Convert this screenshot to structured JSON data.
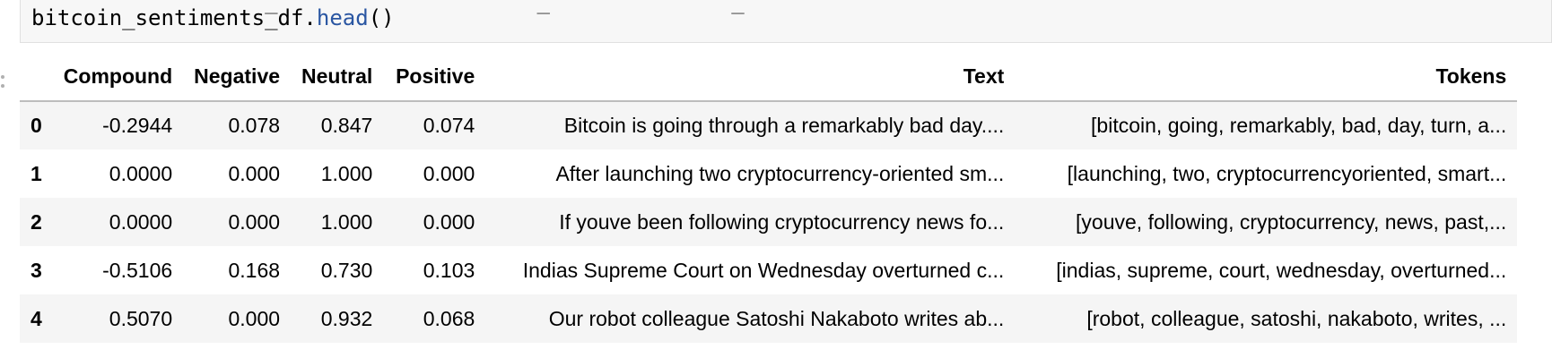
{
  "code_cell": {
    "previous_line_fragment": "                  _                    _              _",
    "line_object": "bitcoin_sentiments_df.",
    "line_method": "head",
    "line_parens": "()"
  },
  "dataframe": {
    "columns": [
      "",
      "Compound",
      "Negative",
      "Neutral",
      "Positive",
      "Text",
      "Tokens"
    ],
    "rows": [
      [
        "0",
        "-0.2944",
        "0.078",
        "0.847",
        "0.074",
        "Bitcoin is going through a remarkably bad day....",
        "[bitcoin, going, remarkably, bad, day, turn, a..."
      ],
      [
        "1",
        "0.0000",
        "0.000",
        "1.000",
        "0.000",
        "After launching two cryptocurrency-oriented sm...",
        "[launching, two, cryptocurrencyoriented, smart..."
      ],
      [
        "2",
        "0.0000",
        "0.000",
        "1.000",
        "0.000",
        "If youve been following cryptocurrency news fo...",
        "[youve, following, cryptocurrency, news, past,..."
      ],
      [
        "3",
        "-0.5106",
        "0.168",
        "0.730",
        "0.103",
        "Indias Supreme Court on Wednesday overturned c...",
        "[indias, supreme, court, wednesday, overturned..."
      ],
      [
        "4",
        "0.5070",
        "0.000",
        "0.932",
        "0.068",
        "Our robot colleague Satoshi Nakaboto writes ab...",
        "[robot, colleague, satoshi, nakaboto, writes, ..."
      ]
    ]
  },
  "colors": {
    "code_background": "#f7f7f7",
    "method_color": "#2a56a2",
    "row_stripe": "#f5f5f5",
    "header_rule": "#bdbdbd"
  },
  "icons": {
    "collapse_handle": "vertical-dots-icon"
  }
}
